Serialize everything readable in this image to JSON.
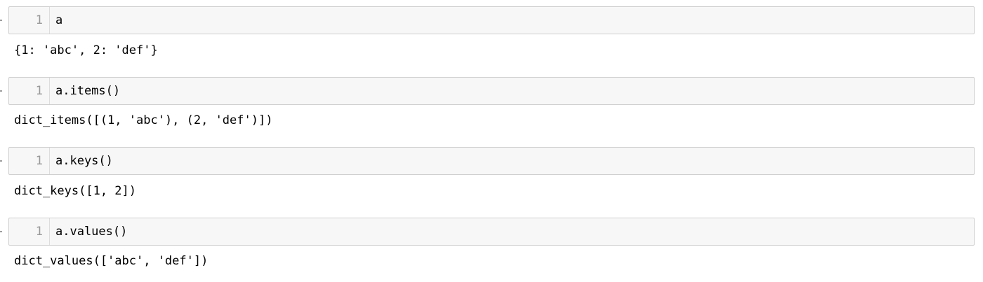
{
  "cells": [
    {
      "line_number": "1",
      "code": "a",
      "output": "{1: 'abc', 2: 'def'}"
    },
    {
      "line_number": "1",
      "code": "a.items()",
      "output": "dict_items([(1, 'abc'), (2, 'def')])"
    },
    {
      "line_number": "1",
      "code": "a.keys()",
      "output": "dict_keys([1, 2])"
    },
    {
      "line_number": "1",
      "code": "a.values()",
      "output": "dict_values(['abc', 'def'])"
    }
  ],
  "colors": {
    "input_background": "#f7f7f7",
    "input_border": "#cfcfcf",
    "line_number": "#999999",
    "text": "#000000"
  }
}
